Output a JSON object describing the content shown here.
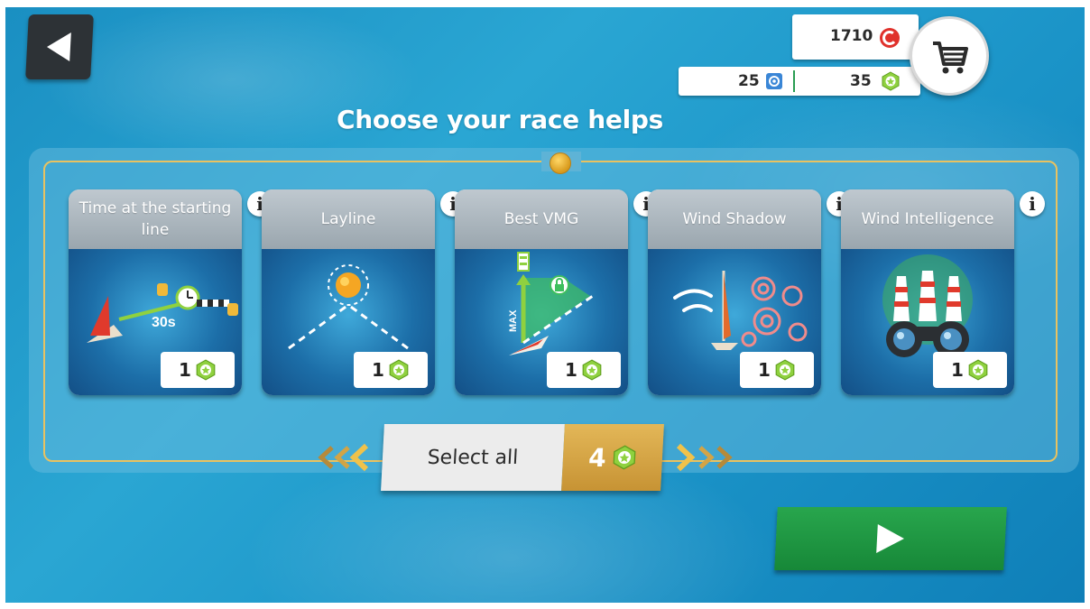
{
  "title": "Choose your race helps",
  "currencies": {
    "coins": "1710",
    "boosts": "25",
    "gems": "35"
  },
  "cards": [
    {
      "title": "Time at the starting line",
      "cost": "1",
      "art_label": "30s"
    },
    {
      "title": "Layline",
      "cost": "1"
    },
    {
      "title": "Best VMG",
      "cost": "1",
      "art_label": "MAX"
    },
    {
      "title": "Wind Shadow",
      "cost": "1"
    },
    {
      "title": "Wind Intelligence",
      "cost": "1"
    }
  ],
  "select_all": {
    "label": "Select all",
    "count": "4"
  },
  "icons": {
    "back": "back-arrow-icon",
    "cart": "shopping-cart-icon",
    "coin": "coin-icon",
    "boost": "boost-icon",
    "gem": "green-hexagon-token-icon",
    "info": "info-icon",
    "play": "play-icon"
  },
  "colors": {
    "accent_gold": "#e3b758",
    "play_green": "#1f9a45",
    "coin_red": "#e0312b",
    "token_green": "#8fd13f",
    "ocean": "#1f96c9"
  }
}
